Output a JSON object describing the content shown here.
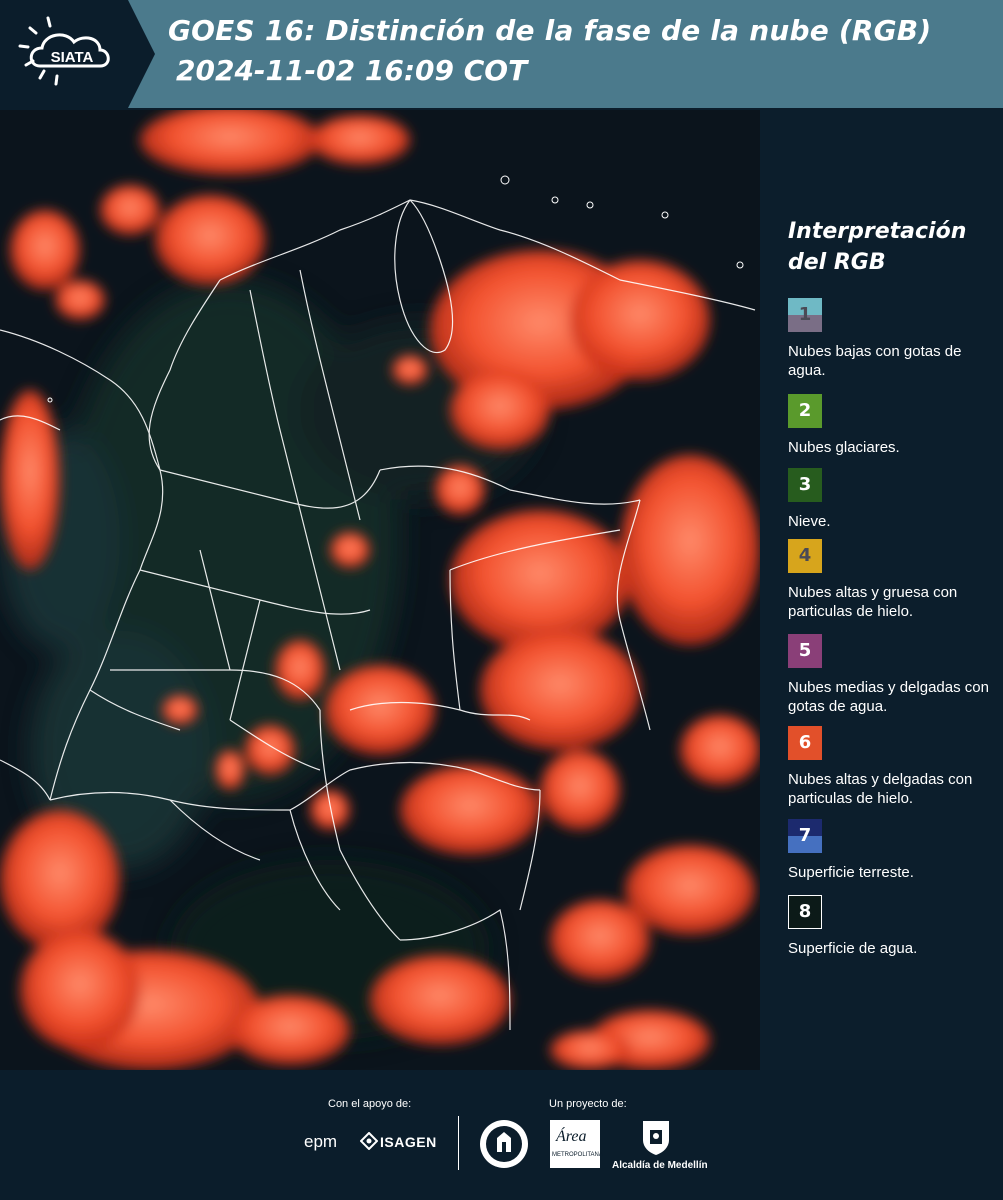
{
  "header": {
    "logo_text": "SIATA",
    "title_line1": "GOES 16: Distinción de la fase de la nube (RGB)",
    "title_line2": "2024-11-02 16:09 COT"
  },
  "legend": {
    "title": "Interpretación del RGB",
    "items": [
      {
        "number": "1",
        "label": "Nubes bajas con gotas de agua.",
        "colors": [
          "#6fb9c5",
          "#7a6e86"
        ],
        "num_color": "#4a4a55"
      },
      {
        "number": "2",
        "label": "Nubes glaciares.",
        "colors": [
          "#5a9a2c",
          "#5a9a2c"
        ],
        "num_color": "#ffffff"
      },
      {
        "number": "3",
        "label": "Nieve.",
        "colors": [
          "#275c1e",
          "#275c1e"
        ],
        "num_color": "#ffffff"
      },
      {
        "number": "4",
        "label": "Nubes altas y gruesa con particulas de hielo.",
        "colors": [
          "#d7a51c",
          "#d7a51c"
        ],
        "num_color": "#4a4a55"
      },
      {
        "number": "5",
        "label": "Nubes medias y delgadas con gotas de agua.",
        "colors": [
          "#8a3f78",
          "#8a3f78"
        ],
        "num_color": "#ffffff"
      },
      {
        "number": "6",
        "label": "Nubes altas y delgadas con particulas de hielo.",
        "colors": [
          "#e2502a",
          "#e2502a"
        ],
        "num_color": "#ffffff"
      },
      {
        "number": "7",
        "label": "Superficie terreste.",
        "colors": [
          "#1c2a6e",
          "#4570c0"
        ],
        "num_color": "#ffffff"
      },
      {
        "number": "8",
        "label": "Superficie de agua.",
        "colors": [
          "#0c1a18",
          "#0c1a18"
        ],
        "num_color": "#ffffff"
      }
    ]
  },
  "footer": {
    "support_caption": "Con el apoyo de:",
    "project_caption": "Un proyecto de:",
    "epm": "epm",
    "isagen": "ISAGEN",
    "area_metropolitana": "Área",
    "area_sub": "METROPOLITANA",
    "alcaldia": "Alcaldía de Medellín"
  }
}
